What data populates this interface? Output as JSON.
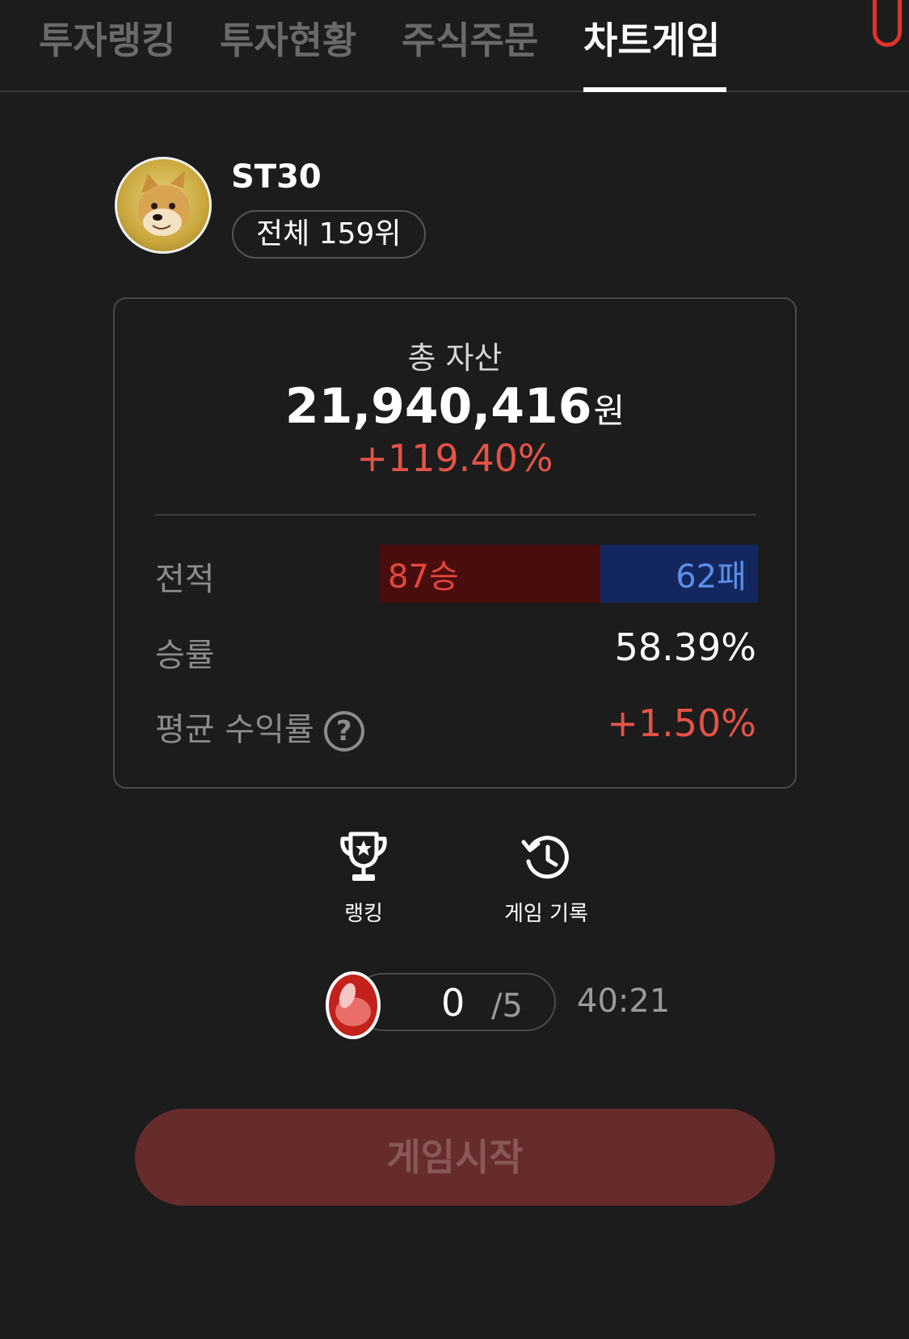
{
  "tabs": [
    {
      "label": "투자랭킹",
      "active": false
    },
    {
      "label": "투자현황",
      "active": false
    },
    {
      "label": "주식주문",
      "active": false
    },
    {
      "label": "차트게임",
      "active": true
    }
  ],
  "profile": {
    "avatar_icon": "shiba-dog-avatar",
    "username": "ST30",
    "rank_label": "전체 159위"
  },
  "summary": {
    "label": "총 자산",
    "amount": "21,940,416",
    "unit": "원",
    "rate": "+119.40%",
    "rate_color": "#e45347",
    "record_label": "전적",
    "wins": "87승",
    "losses": "62패",
    "win_count": 87,
    "loss_count": 62,
    "win_rate_label": "승률",
    "win_rate": "58.39%",
    "avg_return_label": "평균 수익률",
    "help_icon": "question-circle-icon",
    "avg_return": "+1.50%"
  },
  "actions": {
    "ranking": {
      "label": "랭킹",
      "icon": "trophy-icon"
    },
    "history": {
      "label": "게임 기록",
      "icon": "history-clock-icon"
    }
  },
  "energy": {
    "icon": "red-egg-icon",
    "current": "0",
    "max": "/5",
    "timer": "40:21"
  },
  "start_button": {
    "label": "게임시작"
  },
  "colors": {
    "background": "#1c1c1c",
    "positive": "#e45347",
    "negative": "#5b8ee8",
    "win_bg": "#4a0d0d",
    "loss_bg": "#13275e",
    "start_bg": "#662c2c"
  }
}
